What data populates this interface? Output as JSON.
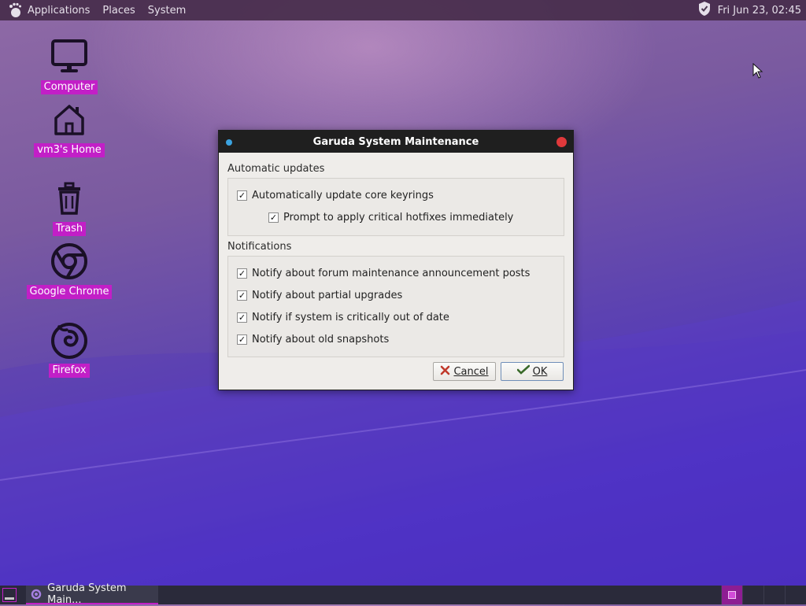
{
  "top_panel": {
    "menus": [
      "Applications",
      "Places",
      "System"
    ],
    "clock": "Fri Jun 23, 02:45"
  },
  "desktop": {
    "icons": [
      {
        "label": "Computer",
        "icon": "computer-icon"
      },
      {
        "label": "vm3's Home",
        "icon": "home-icon"
      },
      {
        "label": "Trash",
        "icon": "trash-icon"
      },
      {
        "label": "Google Chrome",
        "icon": "chrome-icon"
      },
      {
        "label": "Firefox",
        "icon": "firefox-icon"
      }
    ]
  },
  "dialog": {
    "title": "Garuda System Maintenance",
    "sections": [
      {
        "title": "Automatic updates",
        "options": [
          {
            "label": "Automatically update core keyrings",
            "checked": true
          },
          {
            "label": "Prompt to apply critical hotfixes immediately",
            "checked": true
          }
        ]
      },
      {
        "title": "Notifications",
        "options": [
          {
            "label": "Notify about forum maintenance announcement posts",
            "checked": true
          },
          {
            "label": "Notify about partial upgrades",
            "checked": true
          },
          {
            "label": "Notify if system is critically out of date",
            "checked": true
          },
          {
            "label": "Notify about old snapshots",
            "checked": true
          }
        ]
      }
    ],
    "buttons": {
      "cancel_label": "Cancel",
      "ok_label": "OK"
    }
  },
  "taskbar": {
    "task_label": "Garuda System Main..."
  },
  "colors": {
    "accent": "#c21fc7",
    "titlebar": "#1f1f1f",
    "close": "#e0393b"
  }
}
